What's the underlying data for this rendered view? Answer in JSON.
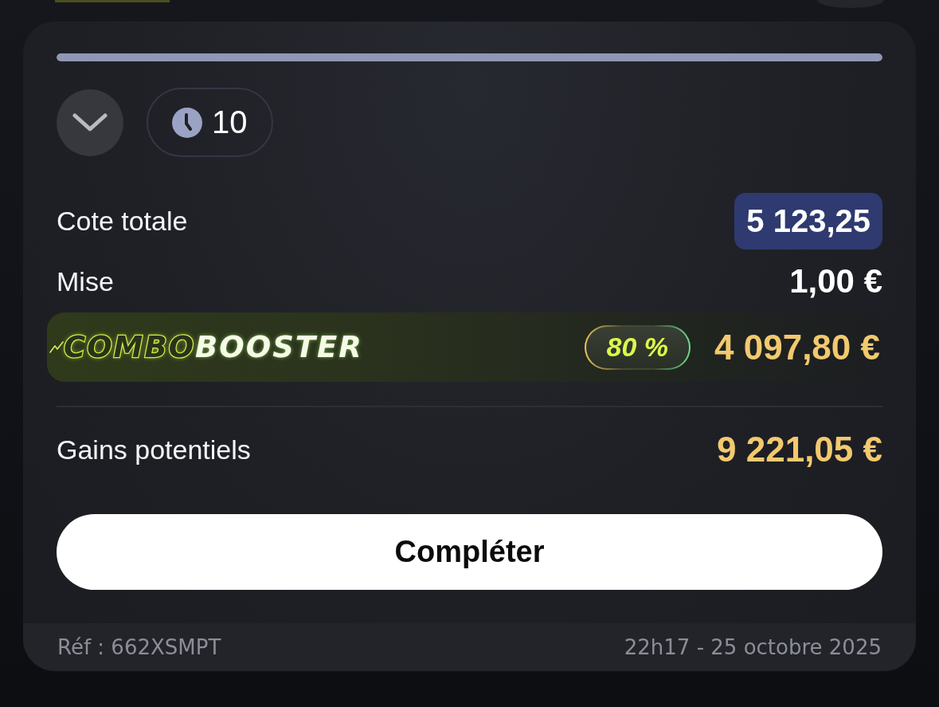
{
  "header": {
    "progress": {
      "level": 1
    },
    "collapse": {
      "expanded": false
    },
    "timer": {
      "value": "10"
    }
  },
  "summary": [
    {
      "label": "Cote totale",
      "value": "5 123,25",
      "kind": "highlight"
    },
    {
      "label": "Mise",
      "value": "1,00 €",
      "kind": "plain"
    }
  ],
  "booster": {
    "logo": {
      "outlined": "COMBO",
      "filled": "BOOSTER"
    },
    "percent": "80 %",
    "amount": "4 097,80 €"
  },
  "total": {
    "label": "Gains potentiels",
    "value": "9 221,05 €"
  },
  "action": {
    "label": "Compléter"
  },
  "footer": {
    "reference": "Réf : 662XSMPT",
    "timestamp": "22h17 - 25 octobre 2025"
  }
}
